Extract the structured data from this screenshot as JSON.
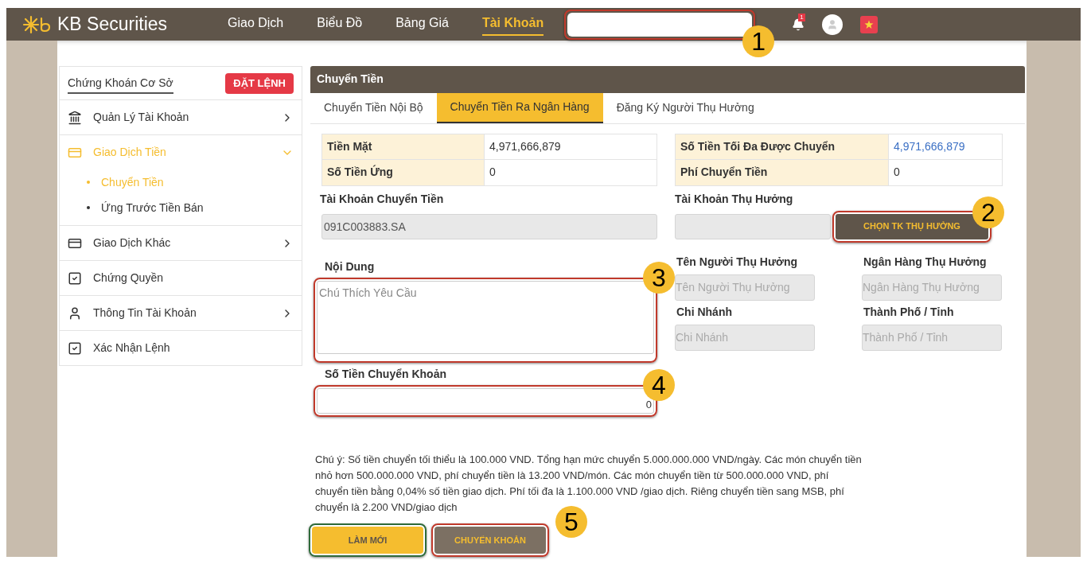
{
  "header": {
    "logo": "KB Securities",
    "nav": [
      {
        "label": "Giao Dịch",
        "selected": false
      },
      {
        "label": "Biểu Đồ",
        "selected": false
      },
      {
        "label": "Bảng Giá",
        "selected": false
      },
      {
        "label": "Tài Khoản",
        "selected": true
      }
    ],
    "search": {
      "callout": "1"
    },
    "notification_count": "1"
  },
  "sidebar": {
    "title": "Chứng Khoán Cơ Sở",
    "order_button": "ĐẶT LỆNH",
    "items": [
      {
        "label": "Quản Lý Tài Khoản",
        "kind": "bank",
        "expanded": false,
        "selected": false
      },
      {
        "label": "Giao Dịch Tiền",
        "kind": "card",
        "expanded": true,
        "selected": true,
        "children": [
          {
            "label": "Chuyển Tiền",
            "selected": true
          },
          {
            "label": "Ứng Trước Tiền Bán",
            "selected": false
          }
        ]
      },
      {
        "label": "Giao Dịch Khác",
        "kind": "card",
        "expanded": false,
        "selected": false
      },
      {
        "label": "Chứng Quyền",
        "kind": "checkbox",
        "selected": false
      },
      {
        "label": "Thông Tin Tài Khoản",
        "kind": "person",
        "expanded": false,
        "selected": false
      },
      {
        "label": "Xác Nhận Lệnh",
        "kind": "checkbox",
        "selected": false
      }
    ]
  },
  "panel": {
    "title": "Chuyển Tiền",
    "tabs": [
      {
        "label": "Chuyển Tiền Nội Bộ",
        "selected": false
      },
      {
        "label": "Chuyển Tiền Ra Ngân Hàng",
        "selected": true
      },
      {
        "label": "Đăng Ký Người Thụ Hưởng",
        "selected": false
      }
    ],
    "summary_left": [
      {
        "label": "Tiền Mặt",
        "value": "4,971,666,879",
        "color": "#333333"
      },
      {
        "label": "Số Tiền Ứng",
        "value": "0",
        "color": "#333333"
      }
    ],
    "summary_right": [
      {
        "label": "Số Tiền Tối Đa Được Chuyển",
        "value": "4,971,666,879",
        "color": "#3a6fc4"
      },
      {
        "label": "Phí Chuyển Tiền",
        "value": "0",
        "color": "#333333"
      }
    ],
    "source_account": {
      "label": "Tài Khoản Chuyển Tiền",
      "value": "091C003883.SA"
    },
    "beneficiary_account": {
      "label": "Tài Khoản Thụ Hưởng",
      "button": "CHỌN TK THỤ HƯỞNG",
      "callout": "2"
    },
    "content": {
      "label": "Nội Dung",
      "placeholder": "Chú Thích Yêu Cầu",
      "callout": "3"
    },
    "beneficiary_details": [
      {
        "label": "Tên Người Thụ Hưởng",
        "placeholder": "Tên Người Thụ Hưởng"
      },
      {
        "label": "Ngân Hàng Thụ Hưởng",
        "placeholder": "Ngân Hàng Thụ Hưởng"
      },
      {
        "label": "Chi Nhánh",
        "placeholder": "Chi Nhánh"
      },
      {
        "label": "Thành Phố / Tỉnh",
        "placeholder": "Thành Phố / Tỉnh"
      }
    ],
    "amount": {
      "label": "Số Tiền Chuyển Khoản",
      "value": "0",
      "callout": "4"
    },
    "note": "Chú ý: Số tiền chuyển tối thiểu là 100.000 VND. Tổng hạn mức chuyển 5.000.000.000 VND/ngày. Các món chuyển tiền nhỏ hơn 500.000.000 VND, phí chuyển tiền là 13.200 VND/món. Các món chuyển tiền từ 500.000.000 VND, phí chuyển tiền bằng 0,04% số tiền giao dịch. Phí tối đa là 1.100.000 VND /giao dịch. Riêng chuyển tiền sang MSB, phí chuyển là 2.200 VND/giao dịch",
    "buttons": [
      {
        "label": "LÀM MỚI",
        "kind": "reset"
      },
      {
        "label": "CHUYỂN KHOẢN",
        "kind": "submit"
      }
    ],
    "buttons_callout": "5"
  }
}
